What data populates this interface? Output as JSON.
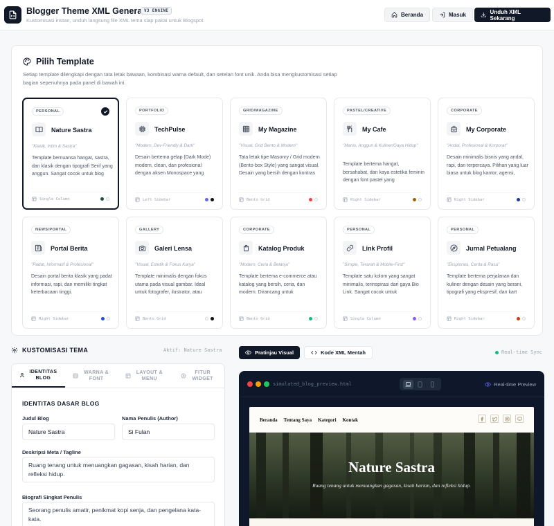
{
  "header": {
    "title": "Blogger Theme XML Generator",
    "badge": "V3 ENGINE",
    "subtitle": "Kustomisasi instan, unduh langsung file XML tema siap pakai untuk Blogspot.",
    "btn_home": "Beranda",
    "btn_login": "Masuk",
    "btn_download": "Unduh XML Sekarang"
  },
  "templates": {
    "title": "Pilih Template",
    "description": "Setiap template dilengkapi dengan tata letak bawaan, kombinasi warna default, dan setelan font unik. Anda bisa mengkustomisasi setiap bagian sepenuhnya pada panel di bawah ini.",
    "cards": [
      {
        "category": "PERSONAL",
        "name": "Nature Sastra",
        "tagline": "\"Klasik, Intim & Sastra\"",
        "desc": "Template bernuansa hangat, sastra, dan klasik dengan tipografi Serif yang anggun. Sangat cocok untuk blog jurnal pribadi, opini,",
        "layout": "Single Column",
        "icon": "book-icon",
        "colors": [
          "#1f4e3d",
          "#ffffff"
        ],
        "selected": true
      },
      {
        "category": "PORTFOLIO",
        "name": "TechPulse",
        "tagline": "\"Modern, Dev-Friendly & Dark\"",
        "desc": "Desain bertema gelap (Dark Mode) modern, clean, dan profesional dengan aksen Monospace yang kental. Sangat ideal untuk",
        "layout": "Left Sidebar",
        "icon": "cpu-icon",
        "colors": [
          "#6366f1",
          "#111111"
        ]
      },
      {
        "category": "GRID/MAGAZINE",
        "name": "My Magazine",
        "tagline": "\"Visual, Grid Bento & Modern\"",
        "desc": "Tata letak tipe Masonry / Grid modern (Bento-box Style) yang sangat visual. Desain yang bersih dengan kontras warna yang",
        "layout": "Bento Grid",
        "icon": "grid-icon",
        "colors": [
          "#ef4444",
          "#ffffff"
        ]
      },
      {
        "category": "PASTEL/CREATIVE",
        "name": "My Cafe",
        "tagline": "\"Manis, Anggun & Kuliner/Gaya Hidup\"",
        "desc": "Template bertema hangat, bersahabat, dan kaya estetika feminin dengan font pastel yang",
        "layout": "Right Sidebar",
        "icon": "utensils-icon",
        "colors": [
          "#a16207",
          "#ffffff"
        ]
      },
      {
        "category": "CORPORATE",
        "name": "My Corporate",
        "tagline": "\"Andal, Profesional & Korporat\"",
        "desc": "Desain minimalis bisnis yang andal, rapi, dan terpercaya. Pilihan yang luar biasa untuk blog kantor, agensi, startup teknologi,",
        "layout": "Right Sidebar",
        "icon": "building-icon",
        "colors": [
          "#1e3a8a",
          "#ffffff"
        ]
      },
      {
        "category": "NEWS/PORTAL",
        "name": "Portal Berita",
        "tagline": "\"Padat, Informatif & Profesional\"",
        "desc": "Desain portal berita klasik yang padat informasi, rapi, dan memiliki tingkat keterbacaan tinggi.",
        "layout": "Right Sidebar",
        "icon": "newspaper-icon",
        "colors": [
          "#1d4ed8",
          "#ffffff"
        ]
      },
      {
        "category": "GALLERY",
        "name": "Galeri Lensa",
        "tagline": "\"Visual, Estetik & Fokus Karya\"",
        "desc": "Template minimalis dengan fokus utama pada visual gambar. Ideal untuk fotografer, ilustrator, atau",
        "layout": "Bento Grid",
        "icon": "camera-icon",
        "colors": [
          "#ffffff",
          "#111111"
        ]
      },
      {
        "category": "CORPORATE",
        "name": "Katalog Produk",
        "tagline": "\"Modern, Ceria & Belanja\"",
        "desc": "Template bertema e-commerce atau katalog yang bersih, ceria, dan modern. Dirancang untuk",
        "layout": "Bento Grid",
        "icon": "bag-icon",
        "colors": [
          "#10b981",
          "#ffffff"
        ]
      },
      {
        "category": "PERSONAL",
        "name": "Link Profil",
        "tagline": "\"Simple, Terarah & Mobile-First\"",
        "desc": "Template satu kolom yang sangat minimalis, terinspirasi dari gaya Bio Link. Sangat cocok untuk",
        "layout": "Single Column",
        "icon": "link-icon",
        "colors": [
          "#8b5cf6",
          "#ffffff"
        ]
      },
      {
        "category": "PERSONAL",
        "name": "Jurnal Petualang",
        "tagline": "\"Eksplorasi, Cerita & Rasa\"",
        "desc": "Template bertema perjalanan dan kuliner dengan desain yang berani, tipografi yang ekspresif, dan kart",
        "layout": "Right Sidebar",
        "icon": "compass-icon",
        "colors": [
          "#c2410c",
          "#ffffff"
        ]
      }
    ]
  },
  "customize": {
    "title": "KUSTOMISASI TEMA",
    "active": "Aktif: Nature Sastra",
    "tabs": [
      {
        "label": "IDENTITAS BLOG",
        "icon": "user-icon"
      },
      {
        "label": "WARNA & FONT",
        "icon": "palette-icon"
      },
      {
        "label": "LAYOUT & MENU",
        "icon": "layout-icon"
      },
      {
        "label": "FITUR WIDGET",
        "icon": "widget-icon"
      }
    ],
    "form_title": "IDENTITAS DASAR BLOG",
    "blog_title_label": "Judul Blog",
    "blog_title_value": "Nature Sastra",
    "author_label": "Nama Penulis (Author)",
    "author_value": "Si Fulan",
    "meta_label": "Deskripsi Meta / Tagline",
    "meta_value": "Ruang tenang untuk menuangkan gagasan, kisah harian, dan refleksi hidup.",
    "bio_label": "Biografi Singkat Penulis",
    "bio_value": "Seorang penulis amatir, penikmat kopi senja, dan pengelana kata-kata."
  },
  "preview": {
    "tab_visual": "Pratinjau Visual",
    "tab_code": "Kode XML Mentah",
    "sync": "Real-time Sync",
    "filename": "simulated_blog_preview.html",
    "realtime": "Real-time Preview",
    "nav": [
      "Beranda",
      "Tentang Saya",
      "Kategori",
      "Kontak"
    ],
    "hero_title": "Nature Sastra",
    "hero_subtitle": "Ruang tenang untuk menuangkan gagasan, kisah harian, dan refleksi hidup."
  },
  "colors": {
    "accent": "#111827",
    "sync_dot": "#10b981",
    "preview_bg": "#0f172a"
  }
}
